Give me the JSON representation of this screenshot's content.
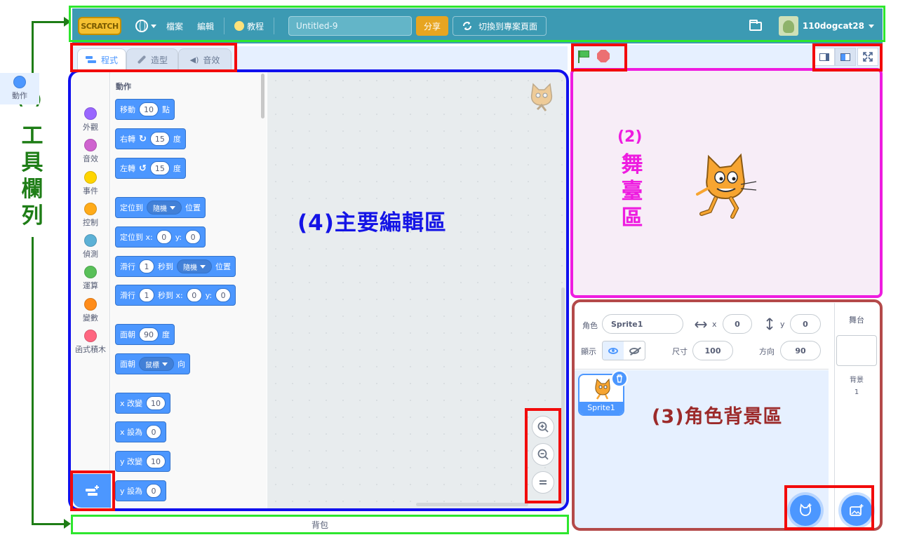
{
  "annotations": {
    "toolbar_num": "(1)",
    "toolbar_text": [
      "工",
      "具",
      "欄",
      "列"
    ],
    "stage_num": "(2)",
    "stage_text": [
      "舞",
      "臺",
      "區"
    ],
    "sprite_area": "(3)角色背景區",
    "editor_area": "(4)主要編輯區"
  },
  "menubar": {
    "logo": "SCRATCH",
    "file": "檔案",
    "edit": "編輯",
    "tutorials": "教程",
    "project_title": "Untitled-9",
    "share": "分享",
    "see_project_page": "切換到專案頁面",
    "username": "110dogcat28"
  },
  "tabs": [
    {
      "label": "程式"
    },
    {
      "label": "造型"
    },
    {
      "label": "音效"
    }
  ],
  "categories": [
    {
      "label": "動作",
      "color": "#4c97ff"
    },
    {
      "label": "外觀",
      "color": "#9966ff"
    },
    {
      "label": "音效",
      "color": "#cf63cf"
    },
    {
      "label": "事件",
      "color": "#ffd500"
    },
    {
      "label": "控制",
      "color": "#ffab19"
    },
    {
      "label": "偵測",
      "color": "#5cb1d6"
    },
    {
      "label": "運算",
      "color": "#59c059"
    },
    {
      "label": "變數",
      "color": "#ff8c1a"
    },
    {
      "label": "函式積木",
      "color": "#ff6680"
    }
  ],
  "palette": {
    "section_title": "動作",
    "blocks": {
      "move": {
        "a": "移動",
        "v": "10",
        "b": "點"
      },
      "turn_right": {
        "a": "右轉",
        "v": "15",
        "b": "度"
      },
      "turn_left": {
        "a": "左轉",
        "v": "15",
        "b": "度"
      },
      "goto": {
        "a": "定位到",
        "dd": "隨機",
        "b": "位置"
      },
      "goto_xy": {
        "a": "定位到 x:",
        "x": "0",
        "ylab": "y:",
        "y": "0"
      },
      "glide": {
        "a": "滑行",
        "v": "1",
        "b": "秒到",
        "dd": "隨機",
        "c": "位置"
      },
      "glide_xy": {
        "a": "滑行",
        "v": "1",
        "b": "秒到 x:",
        "x": "0",
        "ylab": "y:",
        "y": "0"
      },
      "point_dir": {
        "a": "面朝",
        "v": "90",
        "b": "度"
      },
      "point_towards": {
        "a": "面朝",
        "dd": "鼠標",
        "b": "向"
      },
      "change_x": {
        "a": "x 改變",
        "v": "10"
      },
      "set_x": {
        "a": "x 設為",
        "v": "0"
      },
      "change_y": {
        "a": "y 改變",
        "v": "10"
      },
      "set_y": {
        "a": "y 設為",
        "v": "0"
      }
    }
  },
  "backpack": "背包",
  "sprite_info": {
    "sprite_label": "角色",
    "sprite_name": "Sprite1",
    "x_label": "x",
    "x_value": "0",
    "y_label": "y",
    "y_value": "0",
    "show_label": "顯示",
    "size_label": "尺寸",
    "size_value": "100",
    "direction_label": "方向",
    "direction_value": "90"
  },
  "sprite_list": [
    {
      "name": "Sprite1"
    }
  ],
  "stage_pane": {
    "title": "舞台",
    "backdrops_label": "背景",
    "backdrops_count": "1"
  }
}
